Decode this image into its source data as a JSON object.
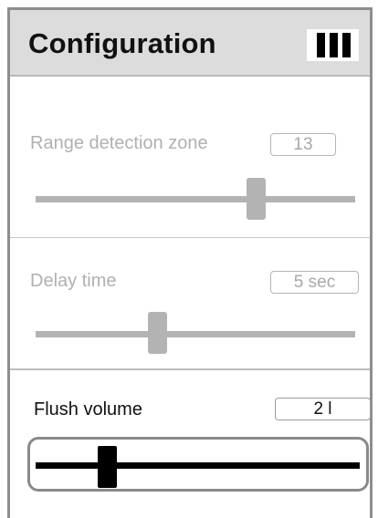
{
  "header": {
    "title": "Configuration",
    "menu_icon": "hamburger-vertical-bars-icon"
  },
  "settings": [
    {
      "label": "Range detection zone",
      "value": "13",
      "slider_position": 0.69,
      "state": "disabled"
    },
    {
      "label": "Delay time",
      "value": "5 sec",
      "slider_position": 0.38,
      "state": "disabled"
    },
    {
      "label": "Flush volume",
      "value": "2 l",
      "slider_position": 0.22,
      "state": "active"
    }
  ],
  "colors": {
    "header_bg": "#dcdcdc",
    "disabled": "#b3b3b3",
    "active": "#000000"
  }
}
